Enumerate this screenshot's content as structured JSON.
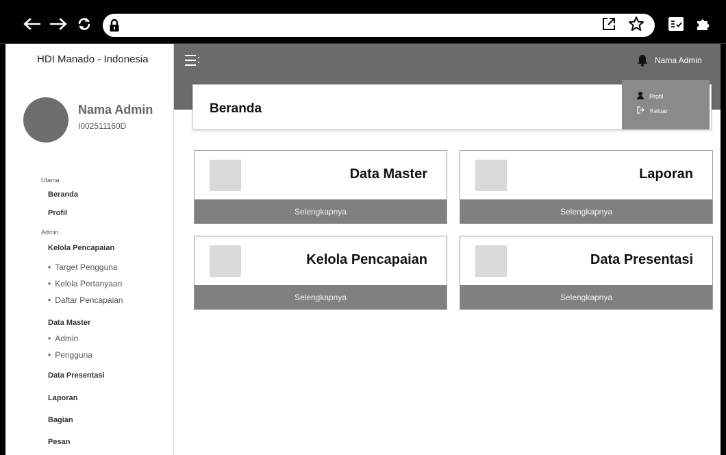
{
  "sidebar": {
    "site_title": "HDI Manado - Indonesia",
    "admin_name": "Nama Admin",
    "admin_id": "I002511160D",
    "section_main": "Utama",
    "section_admin": "Admin",
    "items": {
      "beranda": "Beranda",
      "profil": "Profil",
      "kelola_pencapaian": "Kelola Pencapaian",
      "target_pengguna": "Target Pengguna",
      "kelola_pertanyaan": "Kelola Pertanyaan",
      "daftar_pencapaian": "Daftar Pencapaian",
      "data_master": "Data Master",
      "admin": "Admin",
      "pengguna": "Pengguna",
      "data_presentasi": "Data Presentasi",
      "laporan": "Laporan",
      "bagian": "Bagian",
      "pesan": "Pesan"
    }
  },
  "header": {
    "admin_name": "Nama Admin"
  },
  "dropdown": {
    "profil": "Profil",
    "keluar": "Keluar"
  },
  "page": {
    "title": "Beranda"
  },
  "cards": [
    {
      "title": "Data Master",
      "link": "Selengkapnya"
    },
    {
      "title": "Laporan",
      "link": "Selengkapnya"
    },
    {
      "title": "Kelola Pencapaian",
      "link": "Selengkapnya"
    },
    {
      "title": "Data Presentasi",
      "link": "Selengkapnya"
    }
  ],
  "icons": {
    "back": "arrow-left-icon",
    "forward": "arrow-right-icon",
    "reload": "reload-icon",
    "lock": "lock-icon",
    "open_external": "open-external-icon",
    "bookmark": "star-icon",
    "reading_list": "checklist-icon",
    "extensions": "puzzle-icon",
    "menu": "menu-icon",
    "notifications": "bell-icon",
    "user": "user-icon",
    "logout": "logout-icon"
  },
  "colors": {
    "header_bg": "#6b6b6b",
    "dropdown_bg": "#8a8a8a",
    "card_footer_bg": "#808080",
    "avatar": "#6e6e6e"
  }
}
